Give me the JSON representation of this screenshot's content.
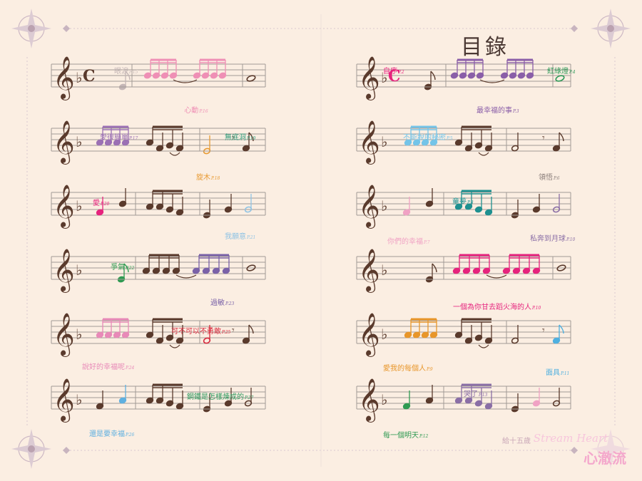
{
  "page_title": "目錄",
  "colors": {
    "staff": "#a29a95",
    "note": "#5a3a2c",
    "border": "#d2c0cb",
    "title": "#4a3833"
  },
  "staves": [
    {
      "id": "L1",
      "time": "C",
      "entries": [
        {
          "text": "眼淚",
          "page": "P.15",
          "color": "#c4b6b6",
          "pos": "above"
        },
        {
          "text": "心動",
          "page": "P.16",
          "color": "#ef8fb5",
          "pos": "below"
        }
      ]
    },
    {
      "id": "L2",
      "entries": [
        {
          "text": "愛很簡單",
          "page": "P.17",
          "color": "#9b70b4",
          "pos": "above"
        },
        {
          "text": "無底洞",
          "page": "P.19",
          "color": "#2d9a78",
          "pos": "above"
        },
        {
          "text": "旋木",
          "page": "P.18",
          "color": "#e89a32",
          "pos": "below"
        }
      ]
    },
    {
      "id": "L3",
      "entries": [
        {
          "text": "愛",
          "page": "P.20",
          "color": "#e6237d",
          "pos": "above"
        },
        {
          "text": "我願意",
          "page": "P.21",
          "color": "#8fc3e4",
          "pos": "below"
        }
      ]
    },
    {
      "id": "L4",
      "entries": [
        {
          "text": "爭氣",
          "page": "P.22",
          "color": "#2f9a52",
          "pos": "above"
        },
        {
          "text": "過敏",
          "page": "P.23",
          "color": "#7a62a8",
          "pos": "below"
        }
      ]
    },
    {
      "id": "L5",
      "entries": [
        {
          "text": "可不可以不勇敢",
          "page": "P.25",
          "color": "#d8283c",
          "pos": "above"
        },
        {
          "text": "說好的幸福呢",
          "page": "P.24",
          "color": "#e88ab8",
          "pos": "below"
        }
      ]
    },
    {
      "id": "L6",
      "entries": [
        {
          "text": "鋼鐵是怎樣煉成的",
          "page": "P.27",
          "color": "#2f9a60",
          "pos": "above"
        },
        {
          "text": "還是要幸福",
          "page": "P.26",
          "color": "#5fb0e0",
          "pos": "below"
        }
      ]
    },
    {
      "id": "R1",
      "time": "C",
      "entries": [
        {
          "text": "自序",
          "page": "P.2",
          "color": "#e6237d",
          "pos": "above"
        },
        {
          "text": "紅綠燈",
          "page": "P.4",
          "color": "#2d9a58",
          "pos": "above"
        },
        {
          "text": "最幸福的事",
          "page": "P.3",
          "color": "#8a5ea8",
          "pos": "below"
        }
      ]
    },
    {
      "id": "R2",
      "entries": [
        {
          "text": "不能說的秘密",
          "page": "P.5",
          "color": "#74c4e8",
          "pos": "above"
        },
        {
          "text": "領悟",
          "page": "P.6",
          "color": "#8a7e7a",
          "pos": "below"
        }
      ]
    },
    {
      "id": "R3",
      "entries": [
        {
          "text": "童夢",
          "page": "P.8",
          "color": "#1e9090",
          "pos": "above"
        },
        {
          "text": "你們的幸福",
          "page": "P.7",
          "color": "#f0a2c4",
          "pos": "below"
        },
        {
          "text": "私奔到月球",
          "page": "P.10",
          "color": "#8a6ea6",
          "pos": "below"
        }
      ]
    },
    {
      "id": "R4",
      "entries": [
        {
          "text": "一個為你甘去蹈火海的人",
          "page": "P.10",
          "color": "#e6237d",
          "pos": "below"
        }
      ]
    },
    {
      "id": "R5",
      "entries": [
        {
          "text": "愛我的每個人",
          "page": "P.9",
          "color": "#e8962a",
          "pos": "below"
        },
        {
          "text": "面具",
          "page": "P.11",
          "color": "#4fb0e0",
          "pos": "below"
        }
      ]
    },
    {
      "id": "R6",
      "entries": [
        {
          "text": "哭了",
          "page": "P.13",
          "color": "#8a6ea6",
          "pos": "above"
        },
        {
          "text": "每一個明天",
          "page": "P.12",
          "color": "#2f9a52",
          "pos": "below"
        },
        {
          "text": "給十五歲",
          "page": "",
          "color": "#caa8b8",
          "pos": "below"
        }
      ]
    }
  ],
  "logo": {
    "script": "Stream Heart",
    "chinese": "心澈流"
  }
}
